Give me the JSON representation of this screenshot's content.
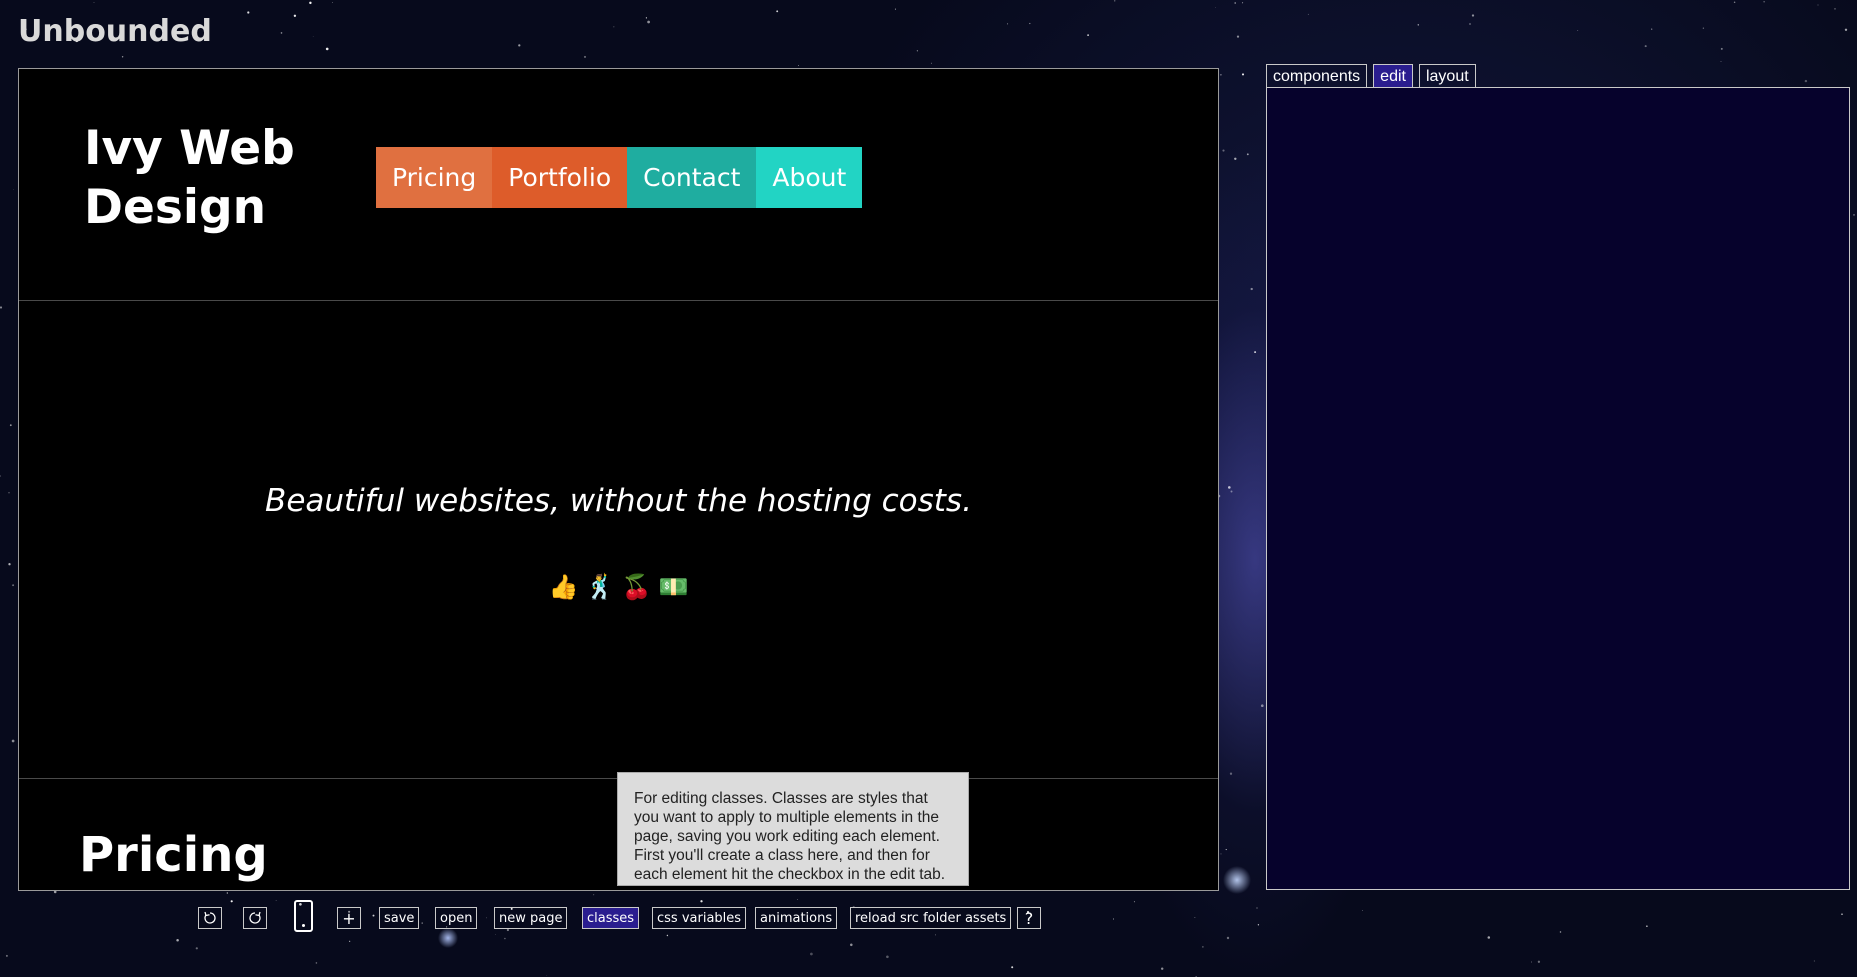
{
  "app": {
    "title": "Unbounded"
  },
  "site": {
    "brand": "Ivy Web Design",
    "nav": [
      {
        "label": "Pricing",
        "color": "#e07040"
      },
      {
        "label": "Portfolio",
        "color": "#dd5c2a"
      },
      {
        "label": "Contact",
        "color": "#1fada0"
      },
      {
        "label": "About",
        "color": "#22d4c4"
      }
    ],
    "tagline": "Beautiful websites, without the hosting costs.",
    "emojis": [
      {
        "glyph": "👍",
        "name": "thumbs-up"
      },
      {
        "glyph": "🕺",
        "name": "dancer"
      },
      {
        "glyph": "🍒",
        "name": "cherries"
      },
      {
        "glyph": "💵",
        "name": "dollar-bill"
      }
    ],
    "section_heading": "Pricing"
  },
  "panel": {
    "tabs": [
      {
        "label": "components",
        "active": false
      },
      {
        "label": "edit",
        "active": true
      },
      {
        "label": "layout",
        "active": false
      }
    ],
    "background": "#06022c"
  },
  "toolbar": {
    "undo_icon": "undo-icon",
    "redo_icon": "redo-icon",
    "mobile_icon": "mobile-preview-icon",
    "add_icon": "plus-icon",
    "add_label": "+",
    "save": "save",
    "open": "open",
    "new_page": "new page",
    "classes": "classes",
    "css_variables": "css variables",
    "animations": "animations",
    "reload": "reload src folder assets",
    "help": "?"
  },
  "tooltip": {
    "text": "For editing classes. Classes are styles that you want to apply to multiple elements in the page, saving you work editing each element. First you'll create a class here, and then for each element hit the checkbox in the edit tab."
  },
  "colors": {
    "accent": "#2a1d8f",
    "page_bg": "#000000",
    "tooltip_bg": "#dcdcdc"
  }
}
